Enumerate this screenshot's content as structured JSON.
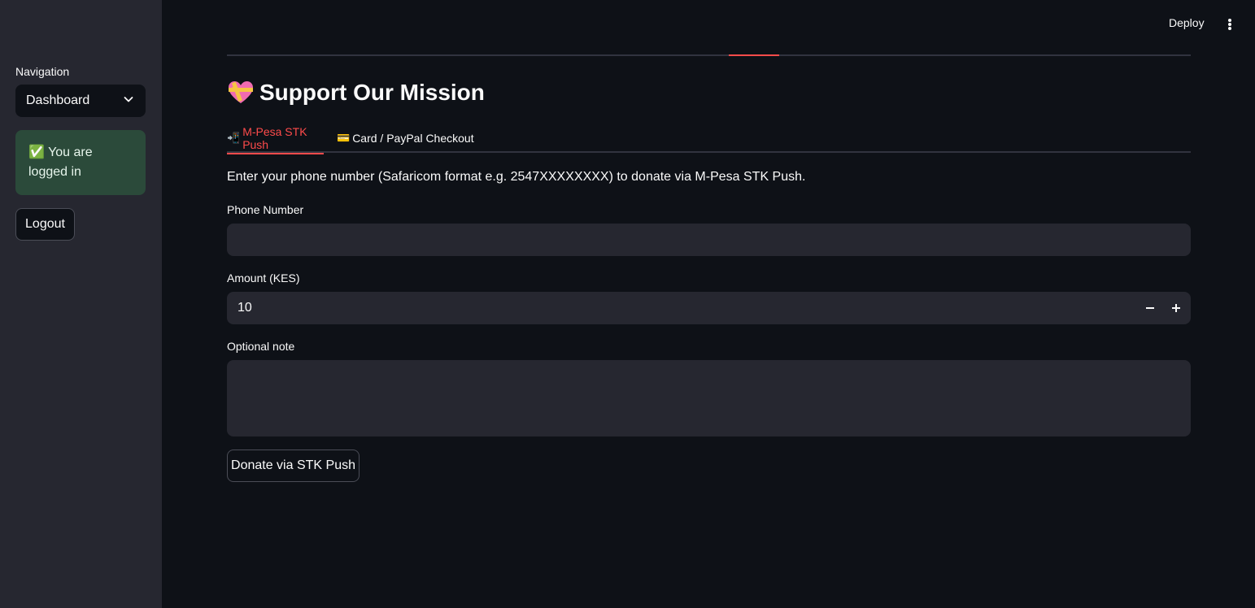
{
  "sidebar": {
    "nav_label": "Navigation",
    "nav_select_value": "Dashboard",
    "login_status": "✅ You are logged in",
    "logout_label": "Logout"
  },
  "header": {
    "deploy_label": "Deploy"
  },
  "main": {
    "title": "Support Our Mission",
    "tabs": [
      {
        "icon": "📲",
        "label": "M-Pesa STK Push",
        "active": true
      },
      {
        "icon": "💳",
        "label": "Card / PayPal Checkout",
        "active": false
      }
    ],
    "description": "Enter your phone number (Safaricom format e.g. 2547XXXXXXXX) to donate via M-Pesa STK Push.",
    "phone": {
      "label": "Phone Number",
      "value": ""
    },
    "amount": {
      "label": "Amount (KES)",
      "value": "10"
    },
    "note": {
      "label": "Optional note",
      "value": ""
    },
    "submit_label": "Donate via STK Push"
  },
  "colors": {
    "accent": "#ff4b4b",
    "background": "#0e1117",
    "sidebar": "#262730",
    "success_bg": "#2b4a3a"
  }
}
